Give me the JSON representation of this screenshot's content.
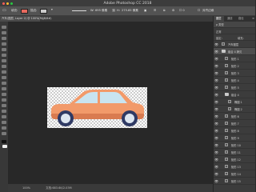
{
  "window": {
    "title": "Adobe Photoshop CC 2018",
    "traffic_colors": [
      "#ff5f57",
      "#febc2e",
      "#28c840"
    ]
  },
  "options_bar": {
    "fill_label": "填充:",
    "fill_color": "#e86a5e",
    "stroke_label": "描边:",
    "w_label": "W:",
    "w_value": "695 像素",
    "link_icon": "link-icon",
    "h_label": "H:",
    "h_value": "275.85 像素",
    "align_edges_label": "对齐边缘"
  },
  "document": {
    "tab_label": "汽车(图层, Layer 2) @ 100%(RGB/8#)",
    "close": "×",
    "status_zoom": "100%",
    "status_doc": "文档:683.6K/2.03M"
  },
  "car": {
    "body_color": "#f29a6a",
    "body_shadow_color": "#d97b50",
    "window_color": "#c9e4f0",
    "wheel_color": "#2f3a64",
    "hub_color": "#dde6f0"
  },
  "layers_panel": {
    "tabs": [
      "图层",
      "通道",
      "路径"
    ],
    "active_tab": 0,
    "filter_label": "ρ 类型",
    "blend_mode": "正常",
    "lock_label": "锁定:",
    "fill_label": "填充:",
    "menu_icon": "panel-menu-icon",
    "layers": [
      {
        "name": "汽车图层",
        "kind": "layer",
        "indent": 0,
        "selected": false
      },
      {
        "name": "组合 4 拷贝",
        "kind": "group",
        "indent": 0,
        "selected": true
      },
      {
        "name": "矩形 1",
        "kind": "layer",
        "indent": 1,
        "selected": false
      },
      {
        "name": "矩形 2",
        "kind": "layer",
        "indent": 1,
        "selected": false
      },
      {
        "name": "矩形 3",
        "kind": "layer",
        "indent": 1,
        "selected": false
      },
      {
        "name": "矩形 4",
        "kind": "layer",
        "indent": 1,
        "selected": false
      },
      {
        "name": "矩形 5",
        "kind": "layer",
        "indent": 1,
        "selected": false
      },
      {
        "name": "组合 4",
        "kind": "group",
        "indent": 1,
        "selected": false
      },
      {
        "name": "椭圆 1",
        "kind": "layer",
        "indent": 2,
        "selected": false
      },
      {
        "name": "椭圆 2",
        "kind": "layer",
        "indent": 2,
        "selected": false
      },
      {
        "name": "矩形 6",
        "kind": "layer",
        "indent": 1,
        "selected": false
      },
      {
        "name": "矩形 7",
        "kind": "layer",
        "indent": 1,
        "selected": false
      },
      {
        "name": "矩形 8",
        "kind": "layer",
        "indent": 1,
        "selected": false
      },
      {
        "name": "矩形 9",
        "kind": "layer",
        "indent": 1,
        "selected": false
      },
      {
        "name": "矩形 10",
        "kind": "layer",
        "indent": 1,
        "selected": false
      },
      {
        "name": "矩形 11",
        "kind": "layer",
        "indent": 1,
        "selected": false
      },
      {
        "name": "矩形 12",
        "kind": "layer",
        "indent": 1,
        "selected": false
      },
      {
        "name": "矩形 13",
        "kind": "layer",
        "indent": 1,
        "selected": false
      },
      {
        "name": "矩形 14",
        "kind": "layer",
        "indent": 1,
        "selected": false
      },
      {
        "name": "矩形 15",
        "kind": "layer",
        "indent": 1,
        "selected": false
      }
    ]
  }
}
